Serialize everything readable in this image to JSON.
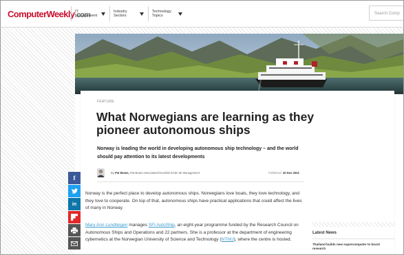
{
  "header": {
    "logo": {
      "part1": "Computer",
      "part2": "Weekly",
      "part3": ".com"
    },
    "nav": [
      {
        "line1": "IT",
        "line2": "Management"
      },
      {
        "line1": "Industry",
        "line2": "Sectors"
      },
      {
        "line1": "Technology",
        "line2": "Topics"
      }
    ],
    "search_placeholder": "Search Comp"
  },
  "article": {
    "kicker": "FEATURE",
    "title": "What Norwegians are learning as they pioneer autonomous ships",
    "standfirst": "Norway is leading the world in developing autonomous ship technology – and the world should pay attention to its latest developments",
    "byline_prefix": "By ",
    "author": "Pat Brans,",
    "author_role": " Pat Brans Associates/Grenoble École de Management",
    "published_label": "Published: ",
    "published_date": "10 Nov 2021",
    "para1": "Norway is the perfect place to develop autonomous ships. Norwegians love boats, they love technology, and they love to cooperate. On top of that, autonomous ships have practical applications that could affect the lives of many in Norway.",
    "para2": {
      "link1": "Mary Ann Lundteigen",
      "text1": " manages ",
      "link2": "SFI AutoShip",
      "text2": ", an eight-year programme funded by the Research Council on Autonomous Ships and Operations and 22 partners. She is a professor at the department of engineering cybernetics at the Norwegian University of Science and Technology (",
      "link3": "NTNU",
      "text3": "), where the centre is hosted."
    }
  },
  "share": [
    {
      "icon": "facebook-icon",
      "glyph": "f",
      "color": "#3b5998"
    },
    {
      "icon": "twitter-icon",
      "glyph": "➔",
      "color": "#1da1f2"
    },
    {
      "icon": "linkedin-icon",
      "glyph": "in",
      "color": "#0e76a8"
    },
    {
      "icon": "flipboard-icon",
      "glyph": "F",
      "color": "#e12828"
    },
    {
      "icon": "print-icon",
      "glyph": "⎙",
      "color": "#555555"
    },
    {
      "icon": "email-icon",
      "glyph": "✉",
      "color": "#555555"
    }
  ],
  "sidebar": {
    "heading": "Latest News",
    "story": "Thailand builds new supercomputer to boost research"
  },
  "colors": {
    "brand_red": "#c8102e",
    "link_blue": "#3d9bd0"
  }
}
